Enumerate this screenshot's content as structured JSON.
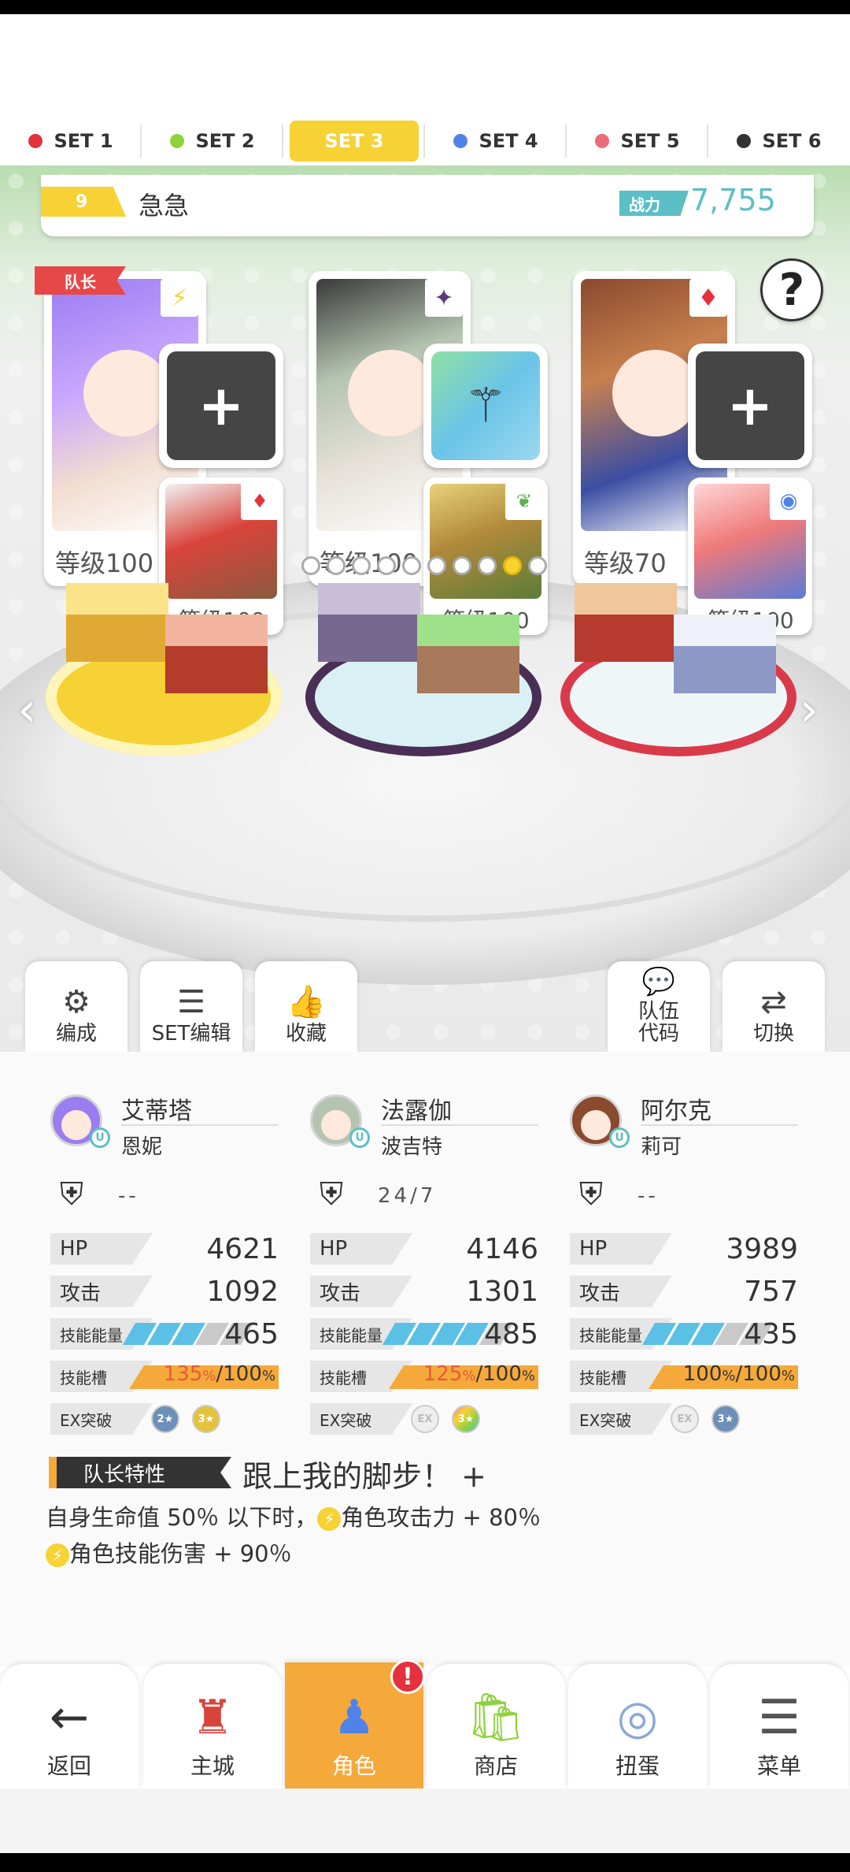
{
  "set_tabs": [
    {
      "label": "SET 1",
      "color": "#e5303d"
    },
    {
      "label": "SET 2",
      "color": "#8ed23c"
    },
    {
      "label": "SET 3",
      "color": "#f6d235"
    },
    {
      "label": "SET 4",
      "color": "#4f83e8"
    },
    {
      "label": "SET 5",
      "color": "#ec6b79"
    },
    {
      "label": "SET 6",
      "color": "#333333"
    }
  ],
  "active_set": "SET 3",
  "team": {
    "number": "9",
    "name": "急急",
    "power_label": "战力",
    "power_value": "7,755"
  },
  "help_label": "?",
  "leader_ribbon": "队长",
  "characters": [
    {
      "level": "等级100",
      "element_icon": "lightning-icon",
      "support_level": "等级100",
      "equipment": "empty"
    },
    {
      "level": "等级100",
      "element_icon": "dark-star-icon",
      "support_level": "等级100",
      "equipment": "magic-wand"
    },
    {
      "level": "等级70",
      "element_icon": "fire-icon",
      "support_level": "等级100",
      "equipment": "empty"
    }
  ],
  "page_dots": {
    "count": 10,
    "active_index": 8
  },
  "actions": {
    "formation": "编成",
    "set_edit": "SET编辑",
    "favorite": "收藏",
    "team_code_line1": "队伍",
    "team_code_line2": "代码",
    "switch": "切换"
  },
  "stats": {
    "hp_label": "HP",
    "atk_label": "攻击",
    "energy_label": "技能能量",
    "slot_label": "技能槽",
    "ex_label": "EX突破",
    "columns": [
      {
        "name": "艾蒂塔",
        "support": "恩妮",
        "equip": "--",
        "hp": "4621",
        "atk": "1092",
        "energy": "465",
        "energy_fill": 0.6,
        "slot_pct": "135",
        "slot_max": "100",
        "slot_fill": 1.0,
        "ex": [
          "2★",
          "3★"
        ]
      },
      {
        "name": "法露伽",
        "support": "波吉特",
        "equip": "24/7",
        "hp": "4146",
        "atk": "1301",
        "energy": "485",
        "energy_fill": 0.8,
        "slot_pct": "125",
        "slot_max": "100",
        "slot_fill": 1.0,
        "ex": [
          "EX",
          "3★"
        ]
      },
      {
        "name": "阿尔克",
        "support": "莉可",
        "equip": "--",
        "hp": "3989",
        "atk": "757",
        "energy": "435",
        "energy_fill": 0.6,
        "slot_pct": "100",
        "slot_max": "100",
        "slot_fill": 0.8,
        "ex": [
          "EX",
          "3★"
        ]
      }
    ]
  },
  "leader_skill": {
    "tag": "队长特性",
    "title": "跟上我的脚步！ +",
    "line1_a": "自身生命值 50％ 以下时，",
    "line1_b": "角色攻击力 + 80％",
    "line2": "角色技能伤害 + 90％"
  },
  "nav": {
    "back": "返回",
    "home": "主城",
    "character": "角色",
    "shop": "商店",
    "gacha": "扭蛋",
    "menu": "菜单",
    "alert": "!"
  }
}
